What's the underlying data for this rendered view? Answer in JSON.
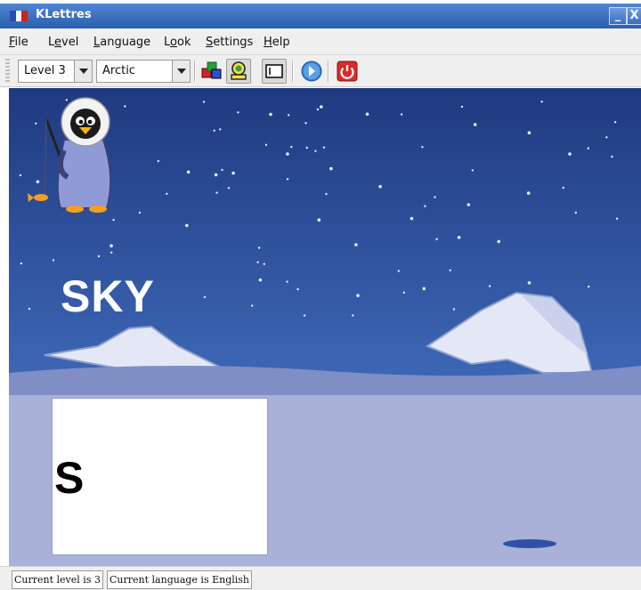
{
  "window": {
    "title": "KLettres",
    "minimize_label": "_",
    "close_label": "X"
  },
  "menu": {
    "items": [
      {
        "label": "File",
        "mnemonic": "F",
        "rest": "ile"
      },
      {
        "label": "Level",
        "mnemonic": "e",
        "rest_before": "L",
        "rest": "vel"
      },
      {
        "label": "Language",
        "mnemonic": "L",
        "rest": "anguage"
      },
      {
        "label": "Look",
        "mnemonic": "o",
        "rest_before": "L",
        "rest": "ok"
      },
      {
        "label": "Settings",
        "mnemonic": "S",
        "rest": "ettings"
      },
      {
        "label": "Help",
        "mnemonic": "H",
        "rest": "elp"
      }
    ]
  },
  "toolbar": {
    "level_combo": "Level 3",
    "theme_combo": "Arctic",
    "buttons": [
      {
        "name": "kid-mode-icon",
        "pressed": false
      },
      {
        "name": "grown-up-mode-icon",
        "pressed": true
      },
      {
        "name": "menubar-toggle-icon",
        "pressed": true
      },
      {
        "name": "next-arrow-icon",
        "pressed": false
      },
      {
        "name": "quit-power-icon",
        "pressed": false
      }
    ]
  },
  "game": {
    "word": "SKY",
    "typed": "S"
  },
  "status": {
    "level_text": "Current level is 3",
    "language_text": "Current language is English"
  },
  "colors": {
    "sky_top": "#1f3a80",
    "sky_bottom": "#3d67b5",
    "ice": "#aab1d8",
    "titlebar": "#3a6fc2"
  }
}
